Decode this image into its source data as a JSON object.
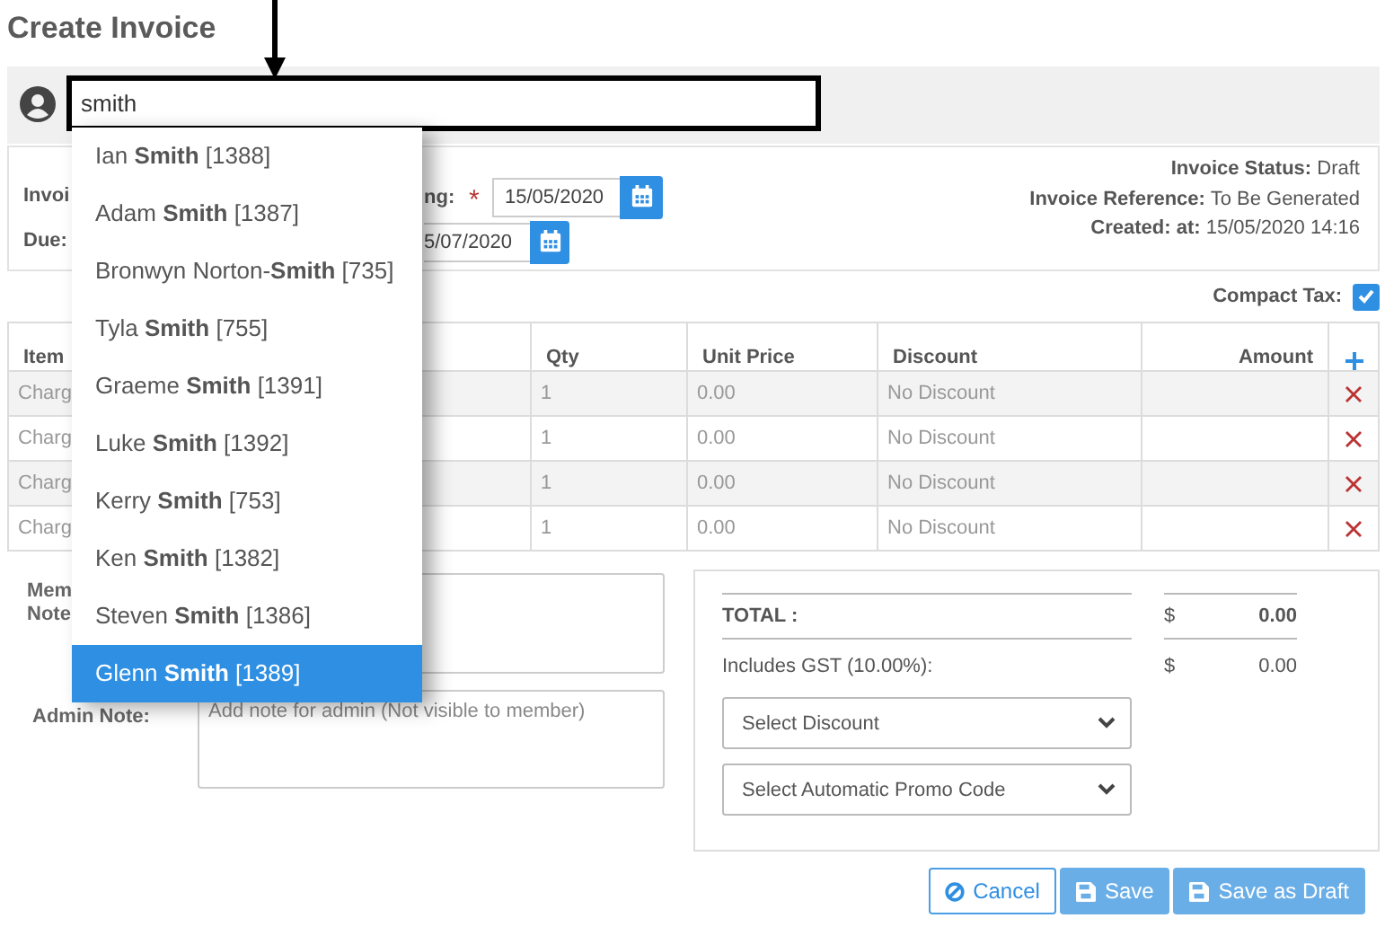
{
  "page": {
    "title": "Create Invoice"
  },
  "member_search": {
    "value": "smith",
    "suggestions": [
      {
        "text": "Ian **Smith** [1388]",
        "selected": false
      },
      {
        "text": "Adam **Smith** [1387]",
        "selected": false
      },
      {
        "text": "Bronwyn Norton-**Smith** [735]",
        "selected": false
      },
      {
        "text": "Tyla **Smith** [755]",
        "selected": false
      },
      {
        "text": "Graeme **Smith** [1391]",
        "selected": false
      },
      {
        "text": "Luke **Smith** [1392]",
        "selected": false
      },
      {
        "text": "Kerry **Smith** [753]",
        "selected": false
      },
      {
        "text": "Ken **Smith** [1382]",
        "selected": false
      },
      {
        "text": "Steven **Smith** [1386]",
        "selected": false
      },
      {
        "text": "Glenn **Smith** [1389]",
        "selected": true
      }
    ]
  },
  "invoice_info": {
    "left_labels": [
      "Invoi",
      "Due:"
    ],
    "invoice_date": {
      "label": "ng:",
      "required_marker": "*",
      "value": "15/05/2020"
    },
    "due_date": {
      "value": "5/07/2020"
    },
    "status": [
      {
        "label": "Invoice Status:",
        "value": "Draft"
      },
      {
        "label": "Invoice Reference:",
        "value": "To Be Generated"
      },
      {
        "label": "Created:  at:",
        "value": "15/05/2020 14:16"
      }
    ]
  },
  "compact_tax": {
    "label": "Compact Tax:",
    "checked": true
  },
  "table": {
    "columns": [
      "Item",
      "Qty",
      "Unit Price",
      "Discount",
      "Amount"
    ],
    "rows": [
      {
        "item": "Charg",
        "qty": "1",
        "unit_price": "0.00",
        "discount": "No Discount"
      },
      {
        "item": "Charg",
        "qty": "1",
        "unit_price": "0.00",
        "discount": "No Discount"
      },
      {
        "item": "Charg",
        "qty": "1",
        "unit_price": "0.00",
        "discount": "No Discount"
      },
      {
        "item": "Charg",
        "qty": "1",
        "unit_price": "0.00",
        "discount": "No Discount"
      }
    ]
  },
  "notes": {
    "member_note_label": [
      "Mem",
      "Note"
    ],
    "admin_note_label": "Admin Note:",
    "admin_note_placeholder": "Add note for admin (Not visible to member)"
  },
  "totals": {
    "total_label": "TOTAL :",
    "total_currency": "$",
    "total_value": "0.00",
    "gst_label": "Includes GST (10.00%):",
    "gst_currency": "$",
    "gst_value": "0.00",
    "selects": [
      "Select Discount",
      "Select Automatic Promo Code"
    ]
  },
  "buttons": [
    {
      "label": "Cancel",
      "kind": "cancel"
    },
    {
      "label": "Save",
      "kind": "save"
    },
    {
      "label": "Save as Draft",
      "kind": "save"
    }
  ]
}
